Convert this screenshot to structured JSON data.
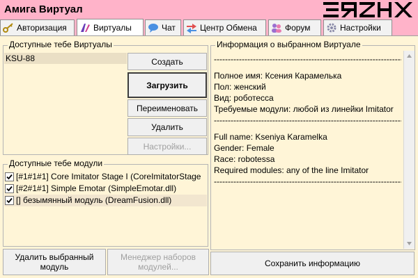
{
  "app": {
    "title": "Амига Виртуал"
  },
  "logo": {
    "text": "ЕЯZHX"
  },
  "tabs": [
    {
      "label": "Авторизация",
      "icon": "key-icon",
      "active": false
    },
    {
      "label": "Виртуалы",
      "icon": "pen-icon",
      "active": true
    },
    {
      "label": "Чат",
      "icon": "chat-bubble-icon",
      "active": false
    },
    {
      "label": "Центр Обмена",
      "icon": "exchange-arrows-icon",
      "active": false
    },
    {
      "label": "Форум",
      "icon": "users-icon",
      "active": false
    },
    {
      "label": "Настройки",
      "icon": "gear-icon",
      "active": false
    }
  ],
  "virtuals": {
    "legend": "Доступные тебе Виртуалы",
    "items": [
      "KSU-88"
    ]
  },
  "actions": {
    "create": "Создать",
    "load": "Загрузить",
    "rename": "Переименовать",
    "delete": "Удалить",
    "settings": "Настройки..."
  },
  "modules": {
    "legend": "Доступные тебе модули",
    "items": [
      {
        "label": "[#1#1#1] Core Imitator Stage I (CoreImitatorStage",
        "checked": true
      },
      {
        "label": "[#2#1#1] Simple Emotar (SimpleEmotar.dll)",
        "checked": true
      },
      {
        "label": "[] безымянный модуль (DreamFusion.dll)",
        "checked": true
      }
    ],
    "delete_button": "Удалить выбранный модуль",
    "manager_button": "Менеджер наборов модулей..."
  },
  "info": {
    "legend": "Информация о выбранном Виртуале",
    "separator": "-------------------------------------------------------------------------",
    "ru": {
      "full_name": "Полное имя: Ксения Карамелька",
      "gender": "Пол: женский",
      "race": "Вид: роботесса",
      "modules": "Требуемые модули: любой из линейки Imitator"
    },
    "en": {
      "full_name": "Full name: Kseniya Karamelka",
      "gender": "Gender: Female",
      "race": "Race: robotessa",
      "modules": "Required modules: any of the line Imitator"
    },
    "save_button": "Сохранить информацию"
  },
  "colors": {
    "background": "#FFB3C9",
    "panel": "#FFF5D7",
    "button": "#F0F0F0",
    "disabled_text": "#A0A0A0"
  }
}
